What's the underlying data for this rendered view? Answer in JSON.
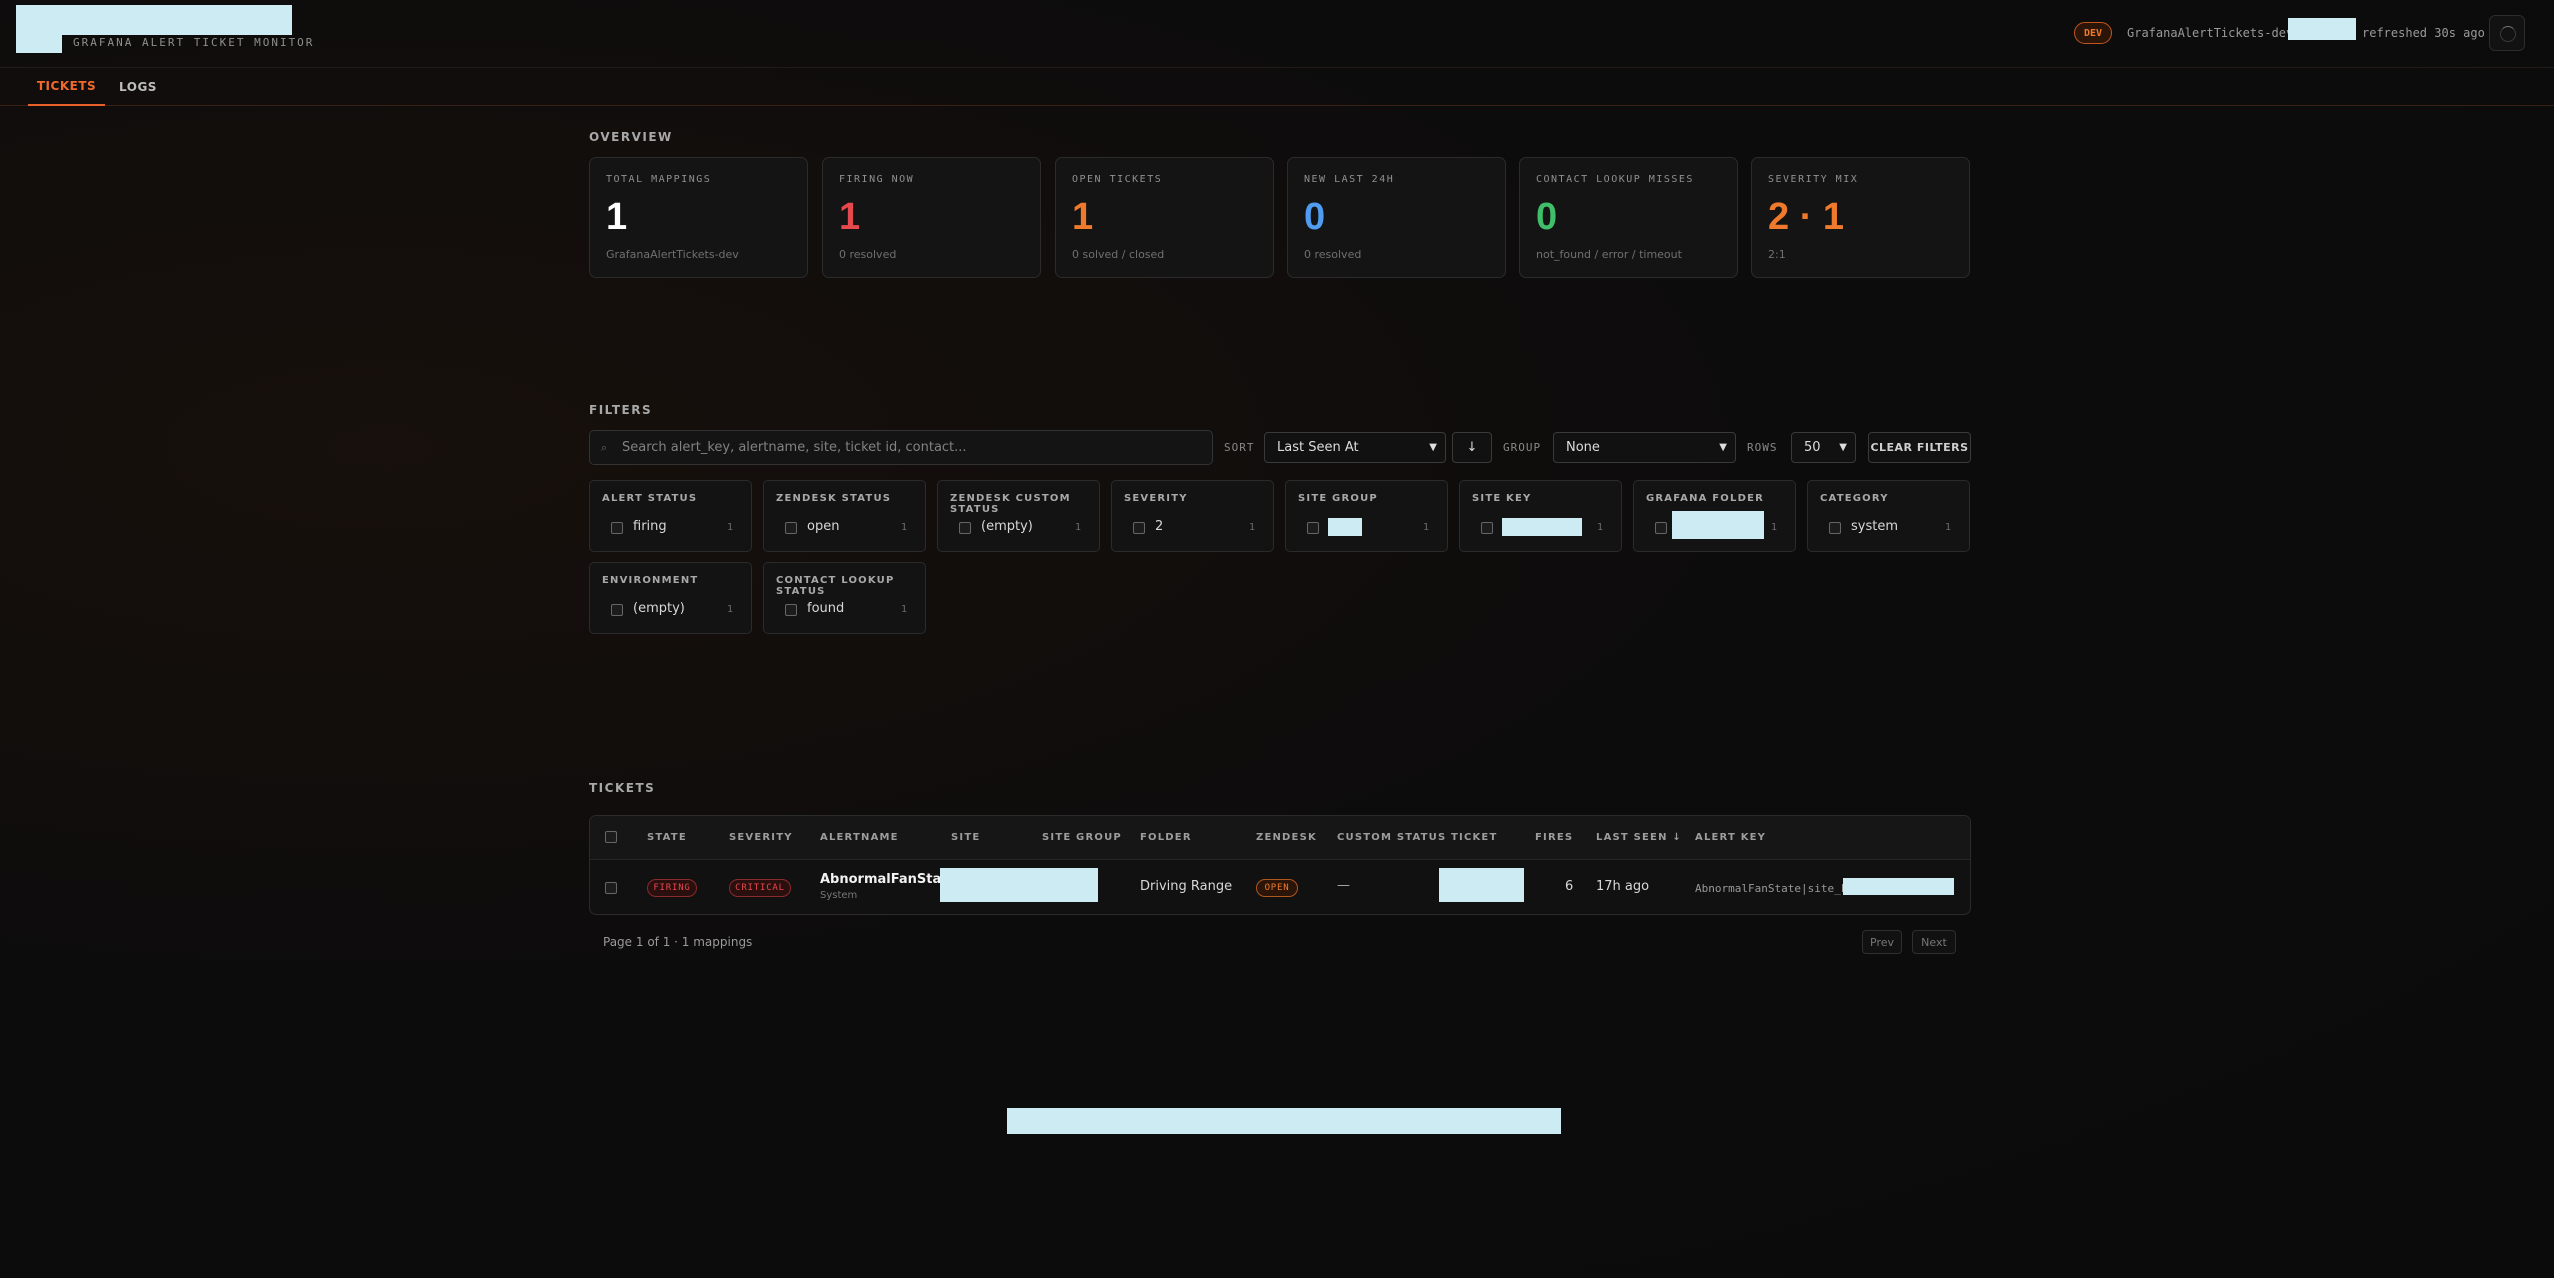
{
  "header": {
    "app_subtitle": "GRAFANA ALERT TICKET MONITOR",
    "env_badge": "DEV",
    "stack_name": "GrafanaAlertTickets-dev",
    "refresh_text": "refreshed 30s ago"
  },
  "tabs": [
    {
      "label": "TICKETS",
      "active": true
    },
    {
      "label": "LOGS",
      "active": false
    }
  ],
  "overview": {
    "title": "OVERVIEW",
    "cards": [
      {
        "label": "TOTAL MAPPINGS",
        "value": "1",
        "sub": "GrafanaAlertTickets-dev",
        "color": "#ffffff"
      },
      {
        "label": "FIRING NOW",
        "value": "1",
        "sub": "0 resolved",
        "color": "#e5484d"
      },
      {
        "label": "OPEN TICKETS",
        "value": "1",
        "sub": "0 solved / closed",
        "color": "#f07a2c"
      },
      {
        "label": "NEW LAST 24H",
        "value": "0",
        "sub": "0 resolved",
        "color": "#4f9cf0"
      },
      {
        "label": "CONTACT LOOKUP MISSES",
        "value": "0",
        "sub": "not_found / error / timeout",
        "color": "#3fbf6a"
      },
      {
        "label": "SEVERITY MIX",
        "value": "2 · 1",
        "sub": "2:1",
        "color": "#f07a2c"
      }
    ]
  },
  "filters": {
    "title": "FILTERS",
    "search_placeholder": "Search alert_key, alertname, site, ticket id, contact...",
    "sort_label": "SORT",
    "sort_value": "Last Seen At",
    "sort_direction": "↓",
    "group_label": "GROUP",
    "group_value": "None",
    "rows_label": "ROWS",
    "rows_value": "50",
    "clear_label": "CLEAR FILTERS",
    "facets": [
      {
        "title": "ALERT STATUS",
        "value": "firing",
        "count": "1"
      },
      {
        "title": "ZENDESK STATUS",
        "value": "open",
        "count": "1"
      },
      {
        "title": "ZENDESK CUSTOM STATUS",
        "value": "(empty)",
        "count": "1"
      },
      {
        "title": "SEVERITY",
        "value": "2",
        "count": "1"
      },
      {
        "title": "SITE GROUP",
        "value": "",
        "count": "1"
      },
      {
        "title": "SITE KEY",
        "value": "",
        "count": "1"
      },
      {
        "title": "GRAFANA FOLDER",
        "value": "",
        "count": "1"
      },
      {
        "title": "CATEGORY",
        "value": "system",
        "count": "1"
      },
      {
        "title": "ENVIRONMENT",
        "value": "(empty)",
        "count": "1"
      },
      {
        "title": "CONTACT LOOKUP STATUS",
        "value": "found",
        "count": "1"
      }
    ]
  },
  "tickets": {
    "title": "TICKETS",
    "columns": [
      "STATE",
      "SEVERITY",
      "ALERTNAME",
      "SITE",
      "SITE GROUP",
      "FOLDER",
      "ZENDESK",
      "CUSTOM STATUS",
      "TICKET",
      "FIRES",
      "LAST SEEN ↓",
      "ALERT KEY"
    ],
    "rows": [
      {
        "state": "FIRING",
        "severity": "CRITICAL",
        "alertname": "AbnormalFanState",
        "category": "System",
        "folder": "Driving Range",
        "zendesk": "OPEN",
        "custom_status": "—",
        "fires": "6",
        "last_seen": "17h ago",
        "alert_key": "AbnormalFanState|site_k"
      }
    ],
    "pager_text": "Page 1 of 1 · 1 mappings",
    "prev_label": "Prev",
    "next_label": "Next"
  }
}
